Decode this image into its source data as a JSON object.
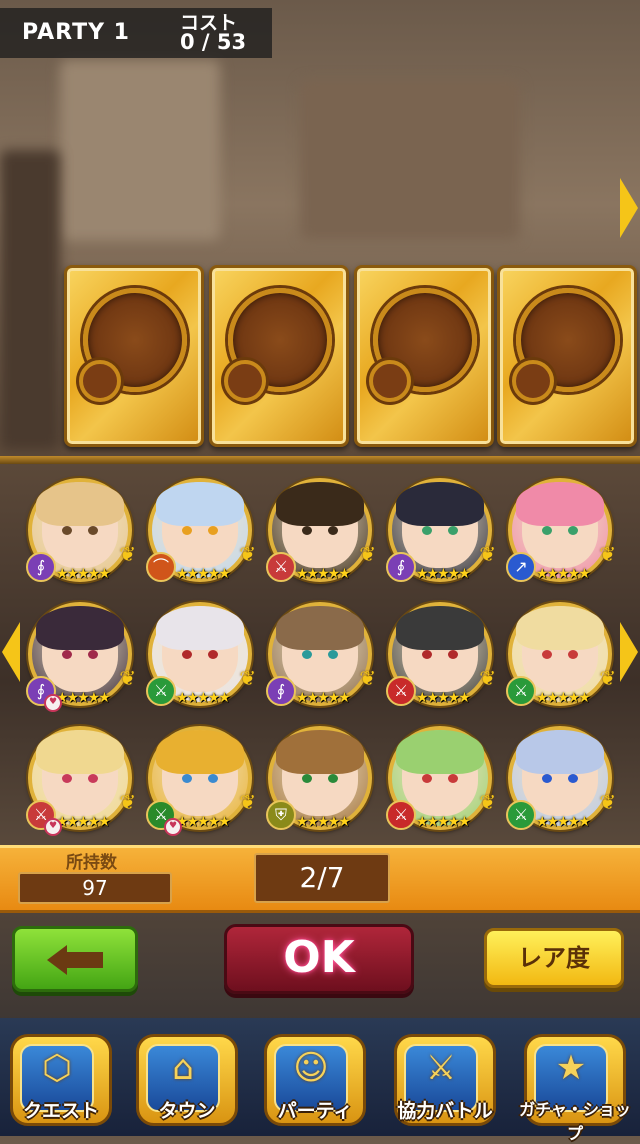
{
  "header": {
    "party_name": "PARTY 1",
    "cost_label": "コスト",
    "cost_value": "0 / 53"
  },
  "party_slots": [
    {
      "state": "empty"
    },
    {
      "state": "empty"
    },
    {
      "state": "empty"
    },
    {
      "state": "empty"
    }
  ],
  "characters": [
    {
      "hair": "#e6c48a",
      "eye": "#6a4a2a",
      "elem_color": "#7b3fb5",
      "elem_icon": "staff-icon",
      "stars": "★★★★★",
      "wings": true,
      "locked": false
    },
    {
      "hair": "#bfd6f0",
      "eye": "#e8a020",
      "elem_color": "#d0551a",
      "elem_icon": "bow-icon",
      "stars": "★★★★★",
      "wings": true,
      "locked": false
    },
    {
      "hair": "#3a2a1a",
      "eye": "#3a2a1a",
      "elem_color": "#c83a3a",
      "elem_icon": "sword-icon",
      "stars": "★★★★★",
      "wings": true,
      "locked": false
    },
    {
      "hair": "#2a2a3a",
      "eye": "#3aa06a",
      "elem_color": "#7b3fb5",
      "elem_icon": "staff-icon",
      "stars": "★★★★★",
      "wings": true,
      "locked": false
    },
    {
      "hair": "#f08aa8",
      "eye": "#3aa06a",
      "elem_color": "#2a5ad0",
      "elem_icon": "spear-icon",
      "stars": "★★★★★",
      "wings": true,
      "locked": false
    },
    {
      "hair": "#3a2a3a",
      "eye": "#a02a4a",
      "elem_color": "#7b3fb5",
      "elem_icon": "staff-icon",
      "stars": "★★★★★",
      "wings": true,
      "locked": true
    },
    {
      "hair": "#e8e4ea",
      "eye": "#b02a2a",
      "elem_color": "#2a9a3a",
      "elem_icon": "sword-icon",
      "stars": "★★★★★",
      "wings": true,
      "locked": false
    },
    {
      "hair": "#8a6a4a",
      "eye": "#2a9a9a",
      "elem_color": "#7b3fb5",
      "elem_icon": "staff-icon",
      "stars": "★★★★★",
      "wings": true,
      "locked": false
    },
    {
      "hair": "#3a3a3a",
      "eye": "#b02a2a",
      "elem_color": "#c82a2a",
      "elem_icon": "sword-icon",
      "stars": "★★★★★",
      "wings": true,
      "locked": false
    },
    {
      "hair": "#f0dca0",
      "eye": "#c83a3a",
      "elem_color": "#2a9a3a",
      "elem_icon": "sword-icon",
      "stars": "★★★★★",
      "wings": true,
      "locked": false
    },
    {
      "hair": "#f0d890",
      "eye": "#c83a5a",
      "elem_color": "#c83a3a",
      "elem_icon": "sword-icon",
      "stars": "★★★★★",
      "wings": true,
      "locked": true
    },
    {
      "hair": "#e8b030",
      "eye": "#3a8ad0",
      "elem_color": "#2a8a2a",
      "elem_icon": "sword-icon",
      "stars": "★★★★★",
      "wings": true,
      "locked": true
    },
    {
      "hair": "#a0703a",
      "eye": "#2a8a3a",
      "elem_color": "#8a8a1a",
      "elem_icon": "shield-icon",
      "stars": "★★★★★",
      "wings": false,
      "locked": false
    },
    {
      "hair": "#9ad070",
      "eye": "#c83a3a",
      "elem_color": "#c82a2a",
      "elem_icon": "sword-icon",
      "stars": "★★★★★",
      "wings": true,
      "locked": false
    },
    {
      "hair": "#b8c8e8",
      "eye": "#2a5ad0",
      "elem_color": "#2a9a3a",
      "elem_icon": "sword-icon",
      "stars": "★★★★★",
      "wings": true,
      "locked": false
    }
  ],
  "counts": {
    "owned_label": "所持数",
    "owned_value": "97",
    "page": "2/7"
  },
  "buttons": {
    "ok": "OK",
    "rarity": "レア度"
  },
  "nav": [
    {
      "label": "クエスト",
      "glyph": "⬡"
    },
    {
      "label": "タウン",
      "glyph": "⌂"
    },
    {
      "label": "パーティ",
      "glyph": "☺"
    },
    {
      "label": "協力バトル",
      "glyph": "⚔"
    },
    {
      "label": "ガチャ・ショップ",
      "glyph": "★"
    }
  ]
}
